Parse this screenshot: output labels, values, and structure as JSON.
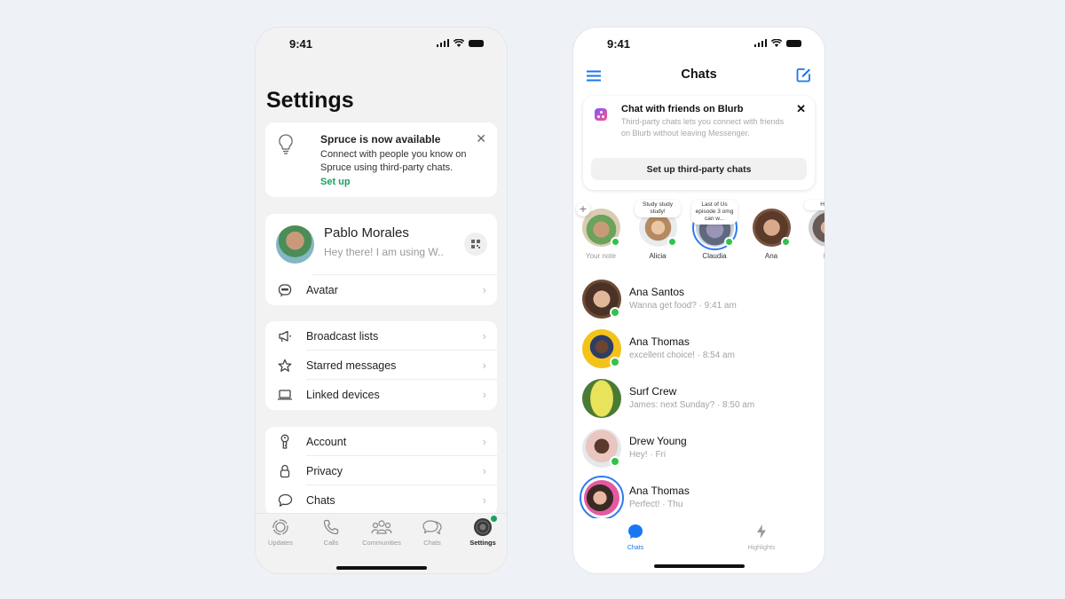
{
  "left_phone": {
    "status_bar": {
      "time": "9:41"
    },
    "title": "Settings",
    "promo": {
      "title": "Spruce is now available",
      "body": "Connect with people you know on Spruce using third-party chats.",
      "link": "Set up",
      "icon": "lightbulb-icon",
      "close_icon": "close-icon"
    },
    "profile": {
      "name": "Pablo Morales",
      "status": "Hey there! I am using W..",
      "qr_icon": "qr-code-icon",
      "avatar_row": {
        "label": "Avatar",
        "icon": "avatar-icon"
      }
    },
    "group2": [
      {
        "label": "Broadcast lists",
        "icon": "megaphone-icon"
      },
      {
        "label": "Starred messages",
        "icon": "star-icon"
      },
      {
        "label": "Linked devices",
        "icon": "laptop-icon"
      }
    ],
    "group3": [
      {
        "label": "Account",
        "icon": "key-icon"
      },
      {
        "label": "Privacy",
        "icon": "lock-icon"
      },
      {
        "label": "Chats",
        "icon": "chat-bubble-icon"
      }
    ],
    "tabs": [
      {
        "label": "Updates",
        "icon": "updates-icon",
        "active": false
      },
      {
        "label": "Calls",
        "icon": "phone-icon",
        "active": false
      },
      {
        "label": "Communities",
        "icon": "communities-icon",
        "active": false
      },
      {
        "label": "Chats",
        "icon": "chats-icon",
        "active": false
      },
      {
        "label": "Settings",
        "icon": "settings-avatar-icon",
        "active": true
      }
    ],
    "accent_color": "#1aa160"
  },
  "right_phone": {
    "status_bar": {
      "time": "9:41"
    },
    "header": {
      "title": "Chats",
      "menu_icon": "hamburger-menu-icon",
      "compose_icon": "compose-icon"
    },
    "banner": {
      "title": "Chat with friends on Blurb",
      "body": "Third-party chats lets you connect with friends on Blurb without leaving Messenger.",
      "button": "Set up third-party chats"
    },
    "stories": [
      {
        "name": "Your note",
        "note": "",
        "online": true
      },
      {
        "name": "Alicia",
        "note": "Study study study!",
        "online": true
      },
      {
        "name": "Claudia",
        "note": "Last of Us episode 3 omg can w...",
        "online": true
      },
      {
        "name": "Ana",
        "note": "",
        "online": true
      },
      {
        "name": "Br",
        "note": "Hang",
        "online": false
      }
    ],
    "chats": [
      {
        "name": "Ana Santos",
        "preview": "Wanna get food? · 9:41 am",
        "online": true,
        "story_ring": false
      },
      {
        "name": "Ana Thomas",
        "preview": "excellent choice! · 8:54 am",
        "online": true,
        "story_ring": false
      },
      {
        "name": "Surf Crew",
        "preview": "James: next Sunday? · 8:50 am",
        "online": false,
        "story_ring": false
      },
      {
        "name": "Drew Young",
        "preview": "Hey! · Fri",
        "online": true,
        "story_ring": false
      },
      {
        "name": "Ana Thomas",
        "preview": "Perfect! · Thu",
        "online": false,
        "story_ring": true
      }
    ],
    "tabs": [
      {
        "label": "Chats",
        "icon": "chat-bubble-filled-icon",
        "active": true
      },
      {
        "label": "Highlights",
        "icon": "lightning-icon",
        "active": false
      }
    ],
    "accent_color": "#1877f2",
    "online_color": "#31c24d"
  }
}
